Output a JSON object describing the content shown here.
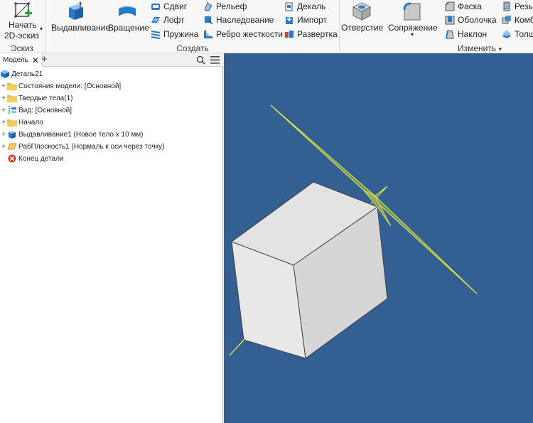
{
  "ribbon": {
    "sketch_panel": {
      "start_sketch_line1": "Начать",
      "start_sketch_line2": "2D-эскиз",
      "label": "Эскиз"
    },
    "create_panel": {
      "extrude": "Выдавливание",
      "revolve": "Вращение",
      "sweep": "Сдвиг",
      "loft": "Лофт",
      "coil": "Пружина",
      "emboss": "Рельеф",
      "derive": "Наследование",
      "rib": "Ребро жесткости",
      "decal": "Декаль",
      "import": "Импорт",
      "unwrap": "Развертка",
      "label": "Создать"
    },
    "modify_panel": {
      "hole": "Отверстие",
      "fillet": "Сопряжение",
      "chamfer": "Фаска",
      "shell": "Оболочка",
      "draft": "Наклон",
      "thread": "Резьба",
      "combine": "Комби",
      "thicken": "Толщ",
      "label": "Изменить"
    },
    "colors": {
      "accent_blue": "#2b79c9",
      "panel_bg": "#f7f7f7"
    }
  },
  "browser": {
    "tab_label": "Модель",
    "tree": {
      "root": "Деталь21",
      "items": [
        {
          "label": "Состояния модели: [Основной]",
          "icon": "folder-icon",
          "expandable": true
        },
        {
          "label": "Твердые тела(1)",
          "icon": "folder-icon",
          "expandable": true
        },
        {
          "label": "Вид: [Основной]",
          "icon": "view-icon",
          "expandable": true
        },
        {
          "label": "Начало",
          "icon": "folder-icon",
          "expandable": true
        },
        {
          "label": "Выдавливание1 (Новое тело x 10 мм)",
          "icon": "extrude-icon",
          "expandable": true
        },
        {
          "label": "РабПлоскость1 (Нормаль к оси через точку)",
          "icon": "workplane-icon",
          "expandable": true
        },
        {
          "label": "Конец детали",
          "icon": "end-of-part-icon",
          "expandable": false
        }
      ]
    }
  },
  "viewport": {
    "background": "#335f93",
    "body_color": "#dcdcdc",
    "workplane_color": "#d8e83a"
  }
}
